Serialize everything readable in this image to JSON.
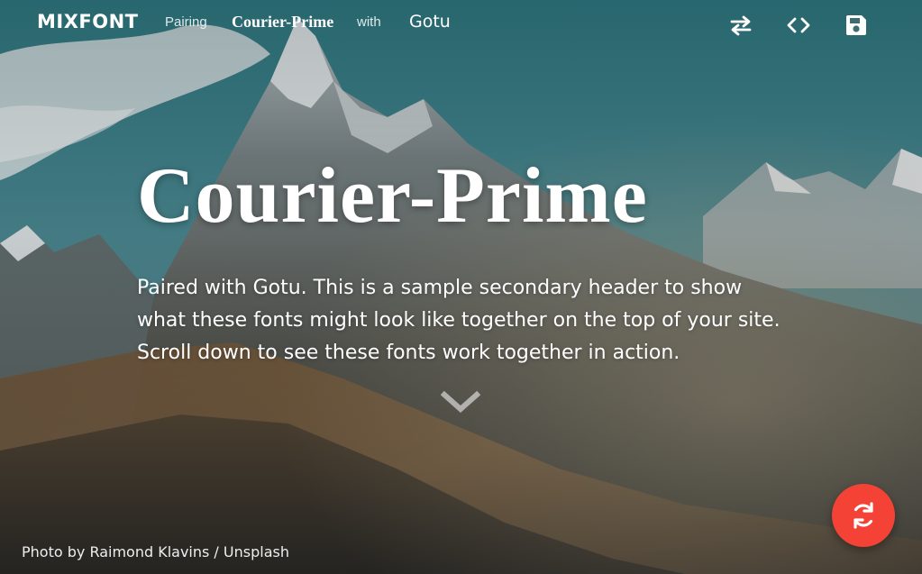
{
  "brand": {
    "name": "MIXFONT"
  },
  "nav": {
    "pairing_label": "Pairing",
    "heading_font": "Courier-Prime",
    "with_label": "with",
    "body_font": "Gotu",
    "icons": [
      "swap-icon",
      "code-icon",
      "save-icon"
    ]
  },
  "hero": {
    "title": "Courier-Prime",
    "subtitle": "Paired with Gotu. This is a sample secondary header to show what these fonts might look like together on the top of your site. Scroll down to see these fonts work together in action.",
    "scroll_icon": "chevron-down-icon"
  },
  "footer": {
    "credit": "Photo by Raimond Klavins / Unsplash"
  },
  "fab": {
    "icon": "refresh-icon",
    "color": "#f44336"
  }
}
